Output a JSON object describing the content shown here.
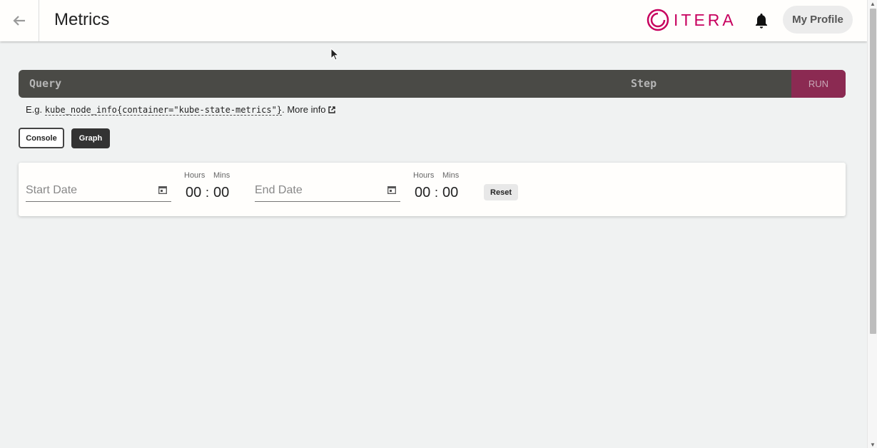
{
  "header": {
    "title": "Metrics",
    "logo_text": "ITERA",
    "profile_label": "My Profile",
    "brand_color": "#c7005e"
  },
  "query": {
    "placeholder": "Query",
    "step_placeholder": "Step",
    "run_label": "RUN"
  },
  "example": {
    "prefix": "E.g.",
    "code": "kube_node_info{container=\"kube-state-metrics\"}",
    "suffix": ".",
    "more_info_label": "More info"
  },
  "tabs": {
    "console_label": "Console",
    "graph_label": "Graph",
    "active": "Graph"
  },
  "range": {
    "start_placeholder": "Start Date",
    "end_placeholder": "End Date",
    "hours_label": "Hours",
    "mins_label": "Mins",
    "start_hours": "00",
    "start_mins": "00",
    "end_hours": "00",
    "end_mins": "00",
    "separator": ":",
    "reset_label": "Reset"
  }
}
